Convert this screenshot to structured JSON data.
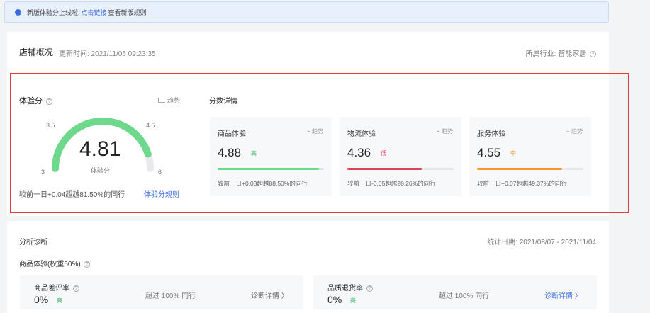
{
  "notice": {
    "text_before": "新版体验分上线啦,",
    "link": "点击链接",
    "text_after": "查看新版规则"
  },
  "overview": {
    "title": "店铺概况",
    "update_time": "更新时间: 2021/11/05 09:23:35",
    "industry": "所属行业: 智能家居"
  },
  "score": {
    "label": "体验分",
    "trend": "趋势",
    "value": "4.81",
    "sub": "体验分",
    "gauge_min": "3",
    "gauge_max": "6",
    "tick_left": "3.5",
    "tick_right": "4.5",
    "gauge_fraction": 0.9,
    "gauge_color": "#6ed98c",
    "compare": "较前一日+0.04超越81.50%的同行",
    "rule_link": "体验分规则"
  },
  "detail": {
    "title": "分数详情",
    "items": [
      {
        "name": "商品体验",
        "trend": "趋势",
        "value": "4.88",
        "level": "高",
        "level_color": "#2fae5e",
        "bar_fraction": 0.95,
        "bar_color": "#6ed98c",
        "compare": "较前一日+0.03超越88.50%的同行"
      },
      {
        "name": "物流体验",
        "trend": "趋势",
        "value": "4.36",
        "level": "低",
        "level_color": "#e2455a",
        "bar_fraction": 0.7,
        "bar_color": "#e2455a",
        "compare": "较前一日-0.05超越28.26%的同行"
      },
      {
        "name": "服务体验",
        "trend": "趋势",
        "value": "4.55",
        "level": "中",
        "level_color": "#f39a2b",
        "bar_fraction": 0.8,
        "bar_color": "#f39a2b",
        "compare": "较前一日+0.07超越49.37%的同行"
      }
    ]
  },
  "analysis": {
    "title": "分析诊断",
    "date": "统计日期: 2021/08/07 - 2021/11/04",
    "weight_label": "商品体验(权重50%)",
    "metrics": [
      {
        "name": "商品差评率",
        "value": "0%",
        "level": "高",
        "exceed": "超过 100% 同行",
        "diagnose": "诊断详情 〉"
      },
      {
        "name": "品质退货率",
        "value": "0%",
        "level": "高",
        "exceed": "超过 100% 同行",
        "diagnose": "诊断详情 〉"
      }
    ]
  }
}
